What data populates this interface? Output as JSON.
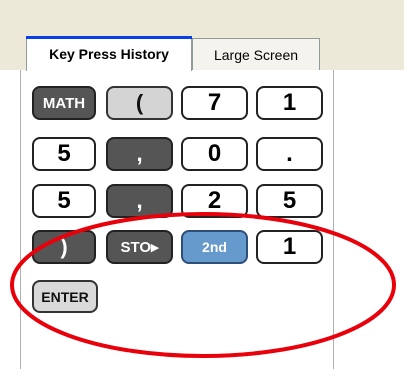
{
  "tabs": {
    "history_label": "Key Press History",
    "large_screen_label": "Large Screen"
  },
  "keys": {
    "row1": [
      "MATH",
      "(",
      "7",
      "1"
    ],
    "row2": [
      "5",
      ",",
      "0",
      "."
    ],
    "row3": [
      "5",
      ",",
      "2",
      "5"
    ],
    "row4": [
      ")",
      "STO▸",
      "2nd",
      "1"
    ],
    "row5": [
      "ENTER"
    ]
  },
  "colors": {
    "dark_key": "#555555",
    "light_key": "#d4d4d4",
    "blue_key": "#6699cc",
    "annotation": "#e8000b",
    "active_tab_accent": "#0a3ee8"
  }
}
